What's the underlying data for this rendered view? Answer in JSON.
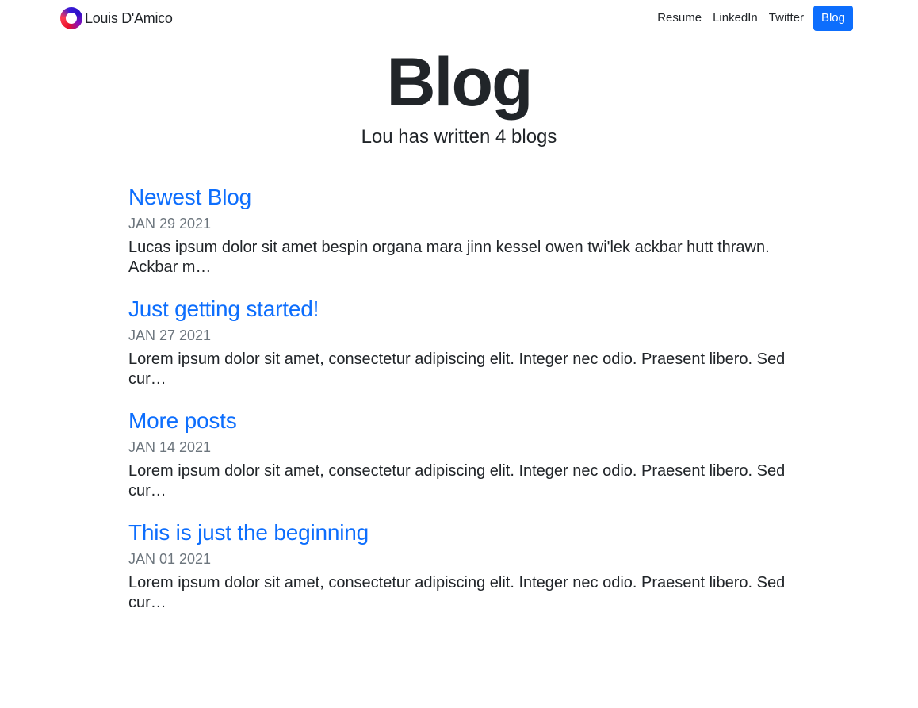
{
  "navbar": {
    "brand_name": "Louis D'Amico",
    "links": [
      {
        "label": "Resume"
      },
      {
        "label": "LinkedIn"
      },
      {
        "label": "Twitter"
      },
      {
        "label": "Blog",
        "active": true
      }
    ]
  },
  "hero": {
    "title": "Blog",
    "subtitle": "Lou has written 4 blogs"
  },
  "posts": [
    {
      "title": "Newest Blog",
      "date": "JAN 29 2021",
      "excerpt": "Lucas ipsum dolor sit amet bespin organa mara jinn kessel owen twi'lek ackbar hutt thrawn. Ackbar m…"
    },
    {
      "title": "Just getting started!",
      "date": "JAN 27 2021",
      "excerpt": "Lorem ipsum dolor sit amet, consectetur adipiscing elit. Integer nec odio. Praesent libero. Sed cur…"
    },
    {
      "title": "More posts",
      "date": "JAN 14 2021",
      "excerpt": "Lorem ipsum dolor sit amet, consectetur adipiscing elit. Integer nec odio. Praesent libero. Sed cur…"
    },
    {
      "title": "This is just the beginning",
      "date": "JAN 01 2021",
      "excerpt": "Lorem ipsum dolor sit amet, consectetur adipiscing elit. Integer nec odio. Praesent libero. Sed cur…"
    }
  ],
  "colors": {
    "accent": "#0d6efd",
    "text": "#212529",
    "muted": "#6c757d"
  }
}
